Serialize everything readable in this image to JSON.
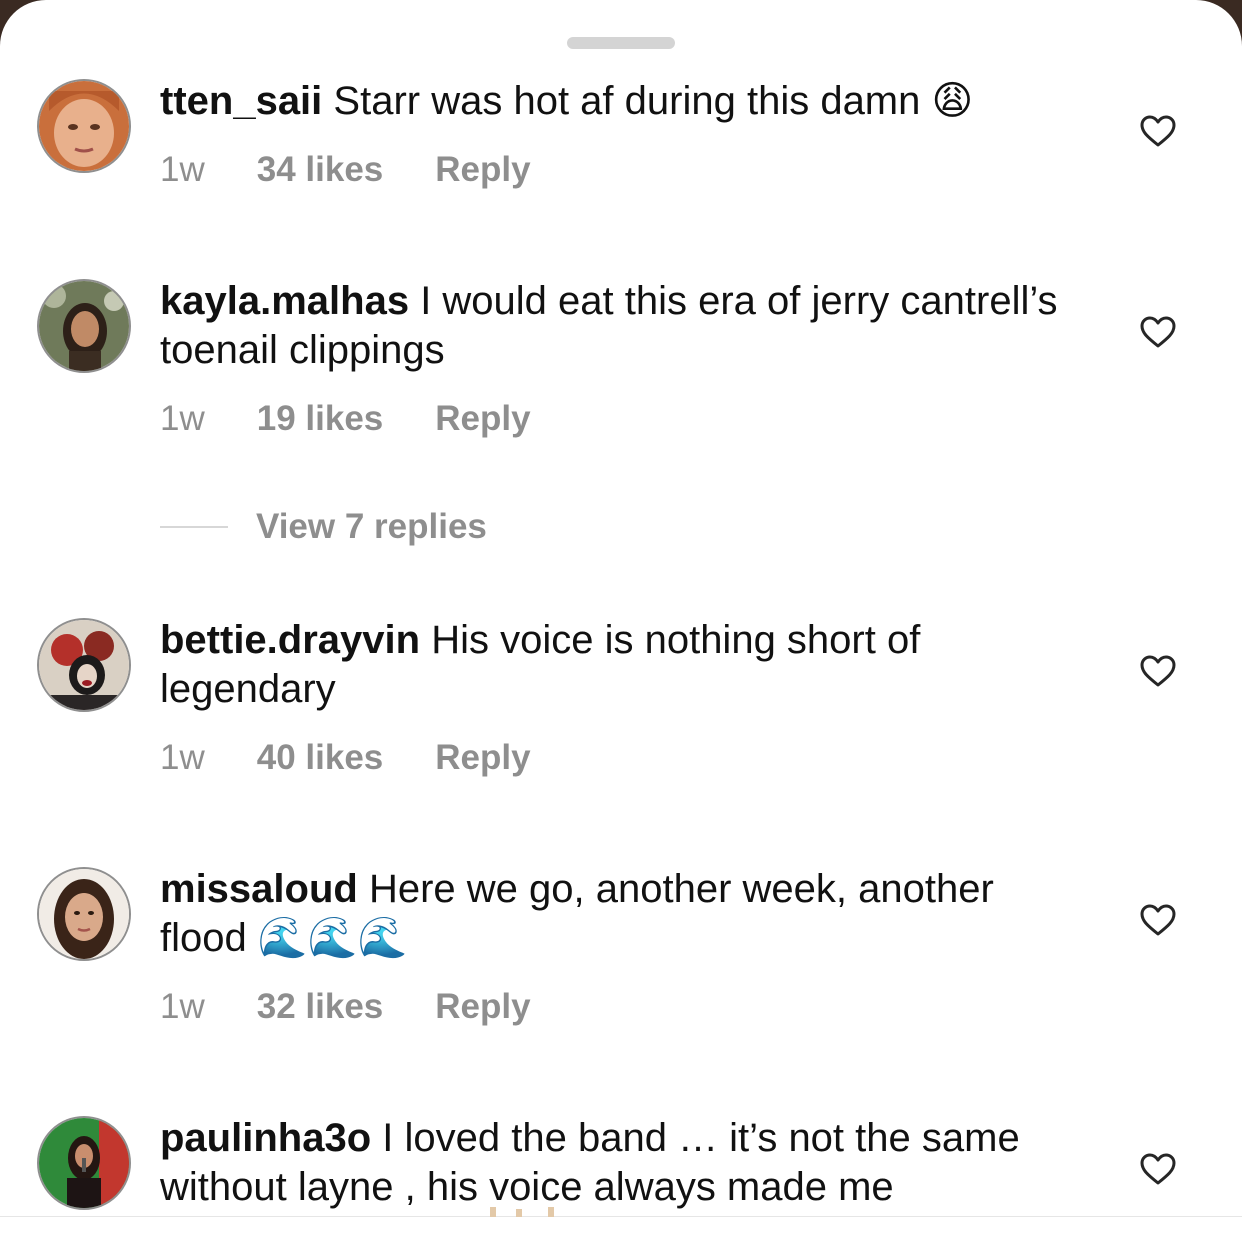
{
  "comments": [
    {
      "username": "tten_saii",
      "text": "Starr was hot af during this damn",
      "emoji": "😩",
      "time": "1w",
      "likes": "34 likes",
      "reply": "Reply"
    },
    {
      "username": "kayla.malhas",
      "text": "I would eat this era of jerry cantrell’s toenail clippings",
      "time": "1w",
      "likes": "19 likes",
      "reply": "Reply",
      "view_replies": "View 7 replies"
    },
    {
      "username": "bettie.drayvin",
      "text": "His voice is nothing short of legendary",
      "time": "1w",
      "likes": "40 likes",
      "reply": "Reply"
    },
    {
      "username": "missaloud",
      "text": "Here we go, another week, another flood",
      "emoji": "🌊🌊🌊",
      "time": "1w",
      "likes": "32 likes",
      "reply": "Reply"
    },
    {
      "username": "paulinha3o",
      "text": "I loved the band … it’s not the same without layne , his voice always made me"
    }
  ],
  "icons": {
    "like": "heart-outline-icon"
  },
  "colors": {
    "text": "#111111",
    "secondary": "#8e8e8e",
    "handle": "#d4d4d4"
  }
}
